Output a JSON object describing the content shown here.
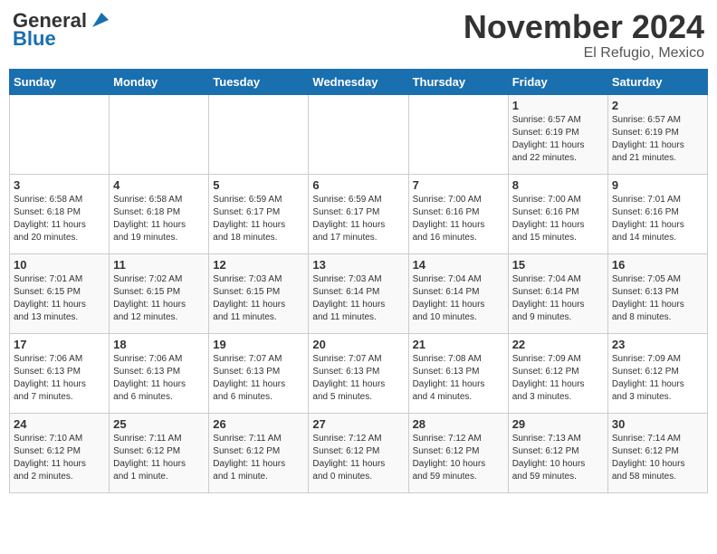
{
  "logo": {
    "line1": "General",
    "line2": "Blue"
  },
  "title": "November 2024",
  "subtitle": "El Refugio, Mexico",
  "days_of_week": [
    "Sunday",
    "Monday",
    "Tuesday",
    "Wednesday",
    "Thursday",
    "Friday",
    "Saturday"
  ],
  "weeks": [
    [
      {
        "day": "",
        "info": ""
      },
      {
        "day": "",
        "info": ""
      },
      {
        "day": "",
        "info": ""
      },
      {
        "day": "",
        "info": ""
      },
      {
        "day": "",
        "info": ""
      },
      {
        "day": "1",
        "info": "Sunrise: 6:57 AM\nSunset: 6:19 PM\nDaylight: 11 hours\nand 22 minutes."
      },
      {
        "day": "2",
        "info": "Sunrise: 6:57 AM\nSunset: 6:19 PM\nDaylight: 11 hours\nand 21 minutes."
      }
    ],
    [
      {
        "day": "3",
        "info": "Sunrise: 6:58 AM\nSunset: 6:18 PM\nDaylight: 11 hours\nand 20 minutes."
      },
      {
        "day": "4",
        "info": "Sunrise: 6:58 AM\nSunset: 6:18 PM\nDaylight: 11 hours\nand 19 minutes."
      },
      {
        "day": "5",
        "info": "Sunrise: 6:59 AM\nSunset: 6:17 PM\nDaylight: 11 hours\nand 18 minutes."
      },
      {
        "day": "6",
        "info": "Sunrise: 6:59 AM\nSunset: 6:17 PM\nDaylight: 11 hours\nand 17 minutes."
      },
      {
        "day": "7",
        "info": "Sunrise: 7:00 AM\nSunset: 6:16 PM\nDaylight: 11 hours\nand 16 minutes."
      },
      {
        "day": "8",
        "info": "Sunrise: 7:00 AM\nSunset: 6:16 PM\nDaylight: 11 hours\nand 15 minutes."
      },
      {
        "day": "9",
        "info": "Sunrise: 7:01 AM\nSunset: 6:16 PM\nDaylight: 11 hours\nand 14 minutes."
      }
    ],
    [
      {
        "day": "10",
        "info": "Sunrise: 7:01 AM\nSunset: 6:15 PM\nDaylight: 11 hours\nand 13 minutes."
      },
      {
        "day": "11",
        "info": "Sunrise: 7:02 AM\nSunset: 6:15 PM\nDaylight: 11 hours\nand 12 minutes."
      },
      {
        "day": "12",
        "info": "Sunrise: 7:03 AM\nSunset: 6:15 PM\nDaylight: 11 hours\nand 11 minutes."
      },
      {
        "day": "13",
        "info": "Sunrise: 7:03 AM\nSunset: 6:14 PM\nDaylight: 11 hours\nand 11 minutes."
      },
      {
        "day": "14",
        "info": "Sunrise: 7:04 AM\nSunset: 6:14 PM\nDaylight: 11 hours\nand 10 minutes."
      },
      {
        "day": "15",
        "info": "Sunrise: 7:04 AM\nSunset: 6:14 PM\nDaylight: 11 hours\nand 9 minutes."
      },
      {
        "day": "16",
        "info": "Sunrise: 7:05 AM\nSunset: 6:13 PM\nDaylight: 11 hours\nand 8 minutes."
      }
    ],
    [
      {
        "day": "17",
        "info": "Sunrise: 7:06 AM\nSunset: 6:13 PM\nDaylight: 11 hours\nand 7 minutes."
      },
      {
        "day": "18",
        "info": "Sunrise: 7:06 AM\nSunset: 6:13 PM\nDaylight: 11 hours\nand 6 minutes."
      },
      {
        "day": "19",
        "info": "Sunrise: 7:07 AM\nSunset: 6:13 PM\nDaylight: 11 hours\nand 6 minutes."
      },
      {
        "day": "20",
        "info": "Sunrise: 7:07 AM\nSunset: 6:13 PM\nDaylight: 11 hours\nand 5 minutes."
      },
      {
        "day": "21",
        "info": "Sunrise: 7:08 AM\nSunset: 6:13 PM\nDaylight: 11 hours\nand 4 minutes."
      },
      {
        "day": "22",
        "info": "Sunrise: 7:09 AM\nSunset: 6:12 PM\nDaylight: 11 hours\nand 3 minutes."
      },
      {
        "day": "23",
        "info": "Sunrise: 7:09 AM\nSunset: 6:12 PM\nDaylight: 11 hours\nand 3 minutes."
      }
    ],
    [
      {
        "day": "24",
        "info": "Sunrise: 7:10 AM\nSunset: 6:12 PM\nDaylight: 11 hours\nand 2 minutes."
      },
      {
        "day": "25",
        "info": "Sunrise: 7:11 AM\nSunset: 6:12 PM\nDaylight: 11 hours\nand 1 minute."
      },
      {
        "day": "26",
        "info": "Sunrise: 7:11 AM\nSunset: 6:12 PM\nDaylight: 11 hours\nand 1 minute."
      },
      {
        "day": "27",
        "info": "Sunrise: 7:12 AM\nSunset: 6:12 PM\nDaylight: 11 hours\nand 0 minutes."
      },
      {
        "day": "28",
        "info": "Sunrise: 7:12 AM\nSunset: 6:12 PM\nDaylight: 10 hours\nand 59 minutes."
      },
      {
        "day": "29",
        "info": "Sunrise: 7:13 AM\nSunset: 6:12 PM\nDaylight: 10 hours\nand 59 minutes."
      },
      {
        "day": "30",
        "info": "Sunrise: 7:14 AM\nSunset: 6:12 PM\nDaylight: 10 hours\nand 58 minutes."
      }
    ]
  ]
}
